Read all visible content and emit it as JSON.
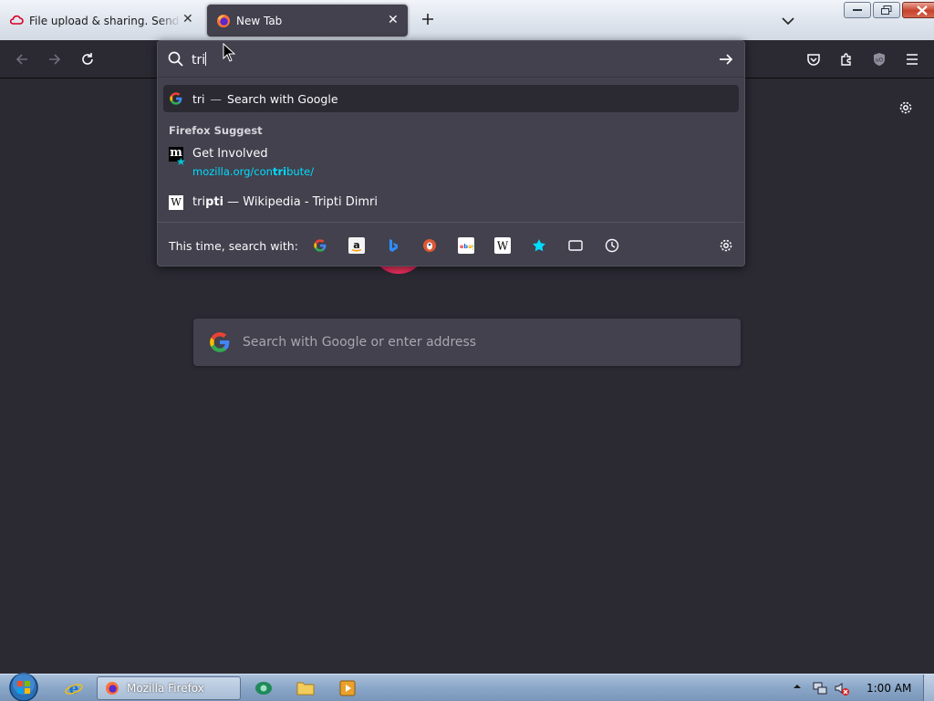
{
  "colors": {
    "toolbar_bg": "#2b2a33",
    "popup_bg": "#42414d",
    "url_accent": "#00ddff",
    "text": "#fbfbfe"
  },
  "tabs": [
    {
      "title": "File upload & sharing. Send large files",
      "icon": "cloud-upload-icon",
      "active": false
    },
    {
      "title": "New Tab",
      "icon": "firefox-icon",
      "active": true
    }
  ],
  "urlbar": {
    "typed_value": "tri",
    "results": {
      "heuristic": {
        "query": "tri",
        "separator": "—",
        "action": "Search with Google"
      },
      "group_label": "Firefox Suggest",
      "suggest": {
        "title": "Get Involved",
        "url_prefix": "mozilla.org/con",
        "url_match": "tri",
        "url_suffix": "bute/"
      },
      "wiki": {
        "match": "tri",
        "rest": "pti",
        "suffix": " — Wikipedia - Tripti Dimri"
      }
    },
    "one_off_label": "This time, search with:",
    "one_off_engines": [
      "Google",
      "Amazon",
      "Bing",
      "DuckDuckGo",
      "eBay",
      "Wikipedia",
      "Bookmarks",
      "Tabs",
      "History"
    ]
  },
  "content": {
    "search_placeholder": "Search with Google or enter address"
  },
  "taskbar": {
    "firefox_task_label": "Mozilla Firefox",
    "clock": "1:00 AM"
  }
}
